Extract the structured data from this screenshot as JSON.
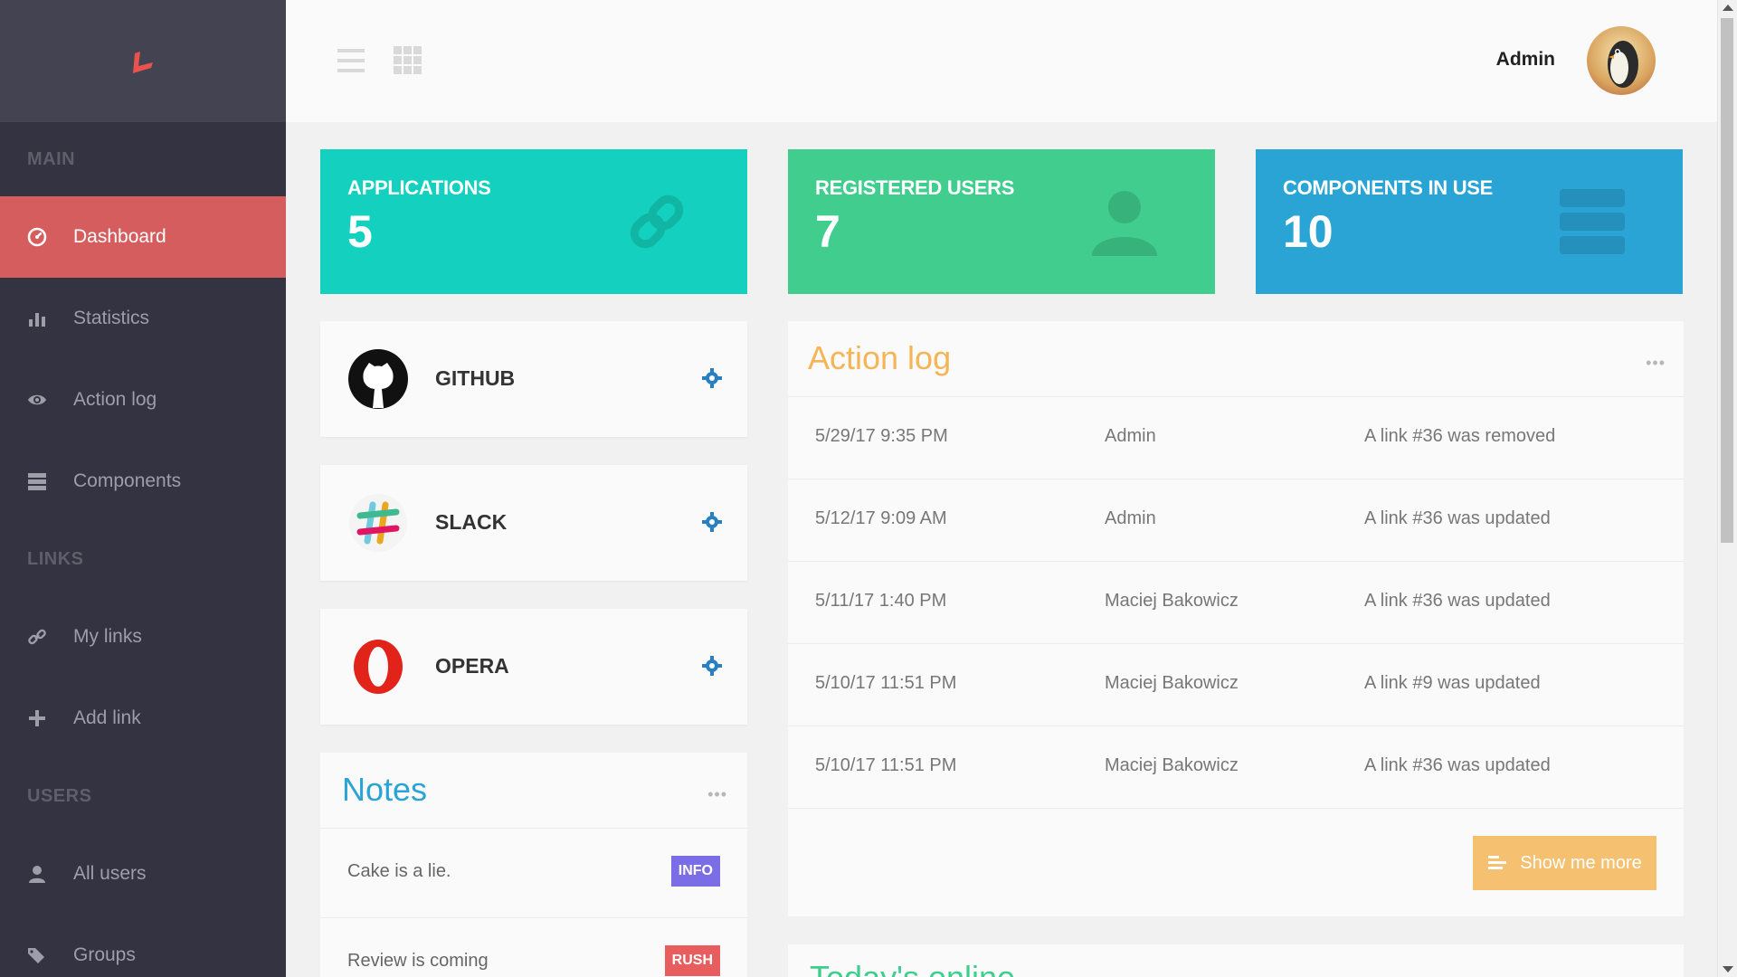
{
  "sidebar": {
    "sections": [
      {
        "title": "MAIN"
      },
      {
        "title": "LINKS"
      },
      {
        "title": "USERS"
      }
    ],
    "items": [
      {
        "label": "Dashboard",
        "icon": "dashboard-icon",
        "active": true
      },
      {
        "label": "Statistics",
        "icon": "bar-chart-icon"
      },
      {
        "label": "Action log",
        "icon": "eye-icon"
      },
      {
        "label": "Components",
        "icon": "server-icon"
      },
      {
        "label": "My links",
        "icon": "link-icon"
      },
      {
        "label": "Add link",
        "icon": "plus-icon"
      },
      {
        "label": "All users",
        "icon": "user-icon"
      },
      {
        "label": "Groups",
        "icon": "tags-icon"
      }
    ]
  },
  "header": {
    "user_name": "Admin"
  },
  "stats": [
    {
      "label": "APPLICATIONS",
      "value": "5",
      "color": "#13d1be"
    },
    {
      "label": "REGISTERED USERS",
      "value": "7",
      "color": "#40cd8e"
    },
    {
      "label": "COMPONENTS IN USE",
      "value": "10",
      "color": "#2aa4d5"
    }
  ],
  "apps": [
    {
      "name": "GITHUB"
    },
    {
      "name": "SLACK"
    },
    {
      "name": "OPERA"
    }
  ],
  "notes": {
    "title": "Notes",
    "more": "•••",
    "items": [
      {
        "text": "Cake is a lie.",
        "badge": "INFO",
        "badge_color": "#7b6de6"
      },
      {
        "text": "Review is coming",
        "badge": "RUSH",
        "badge_color": "#e85d5d"
      }
    ]
  },
  "action_log": {
    "title": "Action log",
    "more": "•••",
    "rows": [
      {
        "date": "5/29/17 9:35 PM",
        "user": "Admin",
        "message": "A link #36 was removed"
      },
      {
        "date": "5/12/17 9:09 AM",
        "user": "Admin",
        "message": "A link #36 was updated"
      },
      {
        "date": "5/11/17 1:40 PM",
        "user": "Maciej Bakowicz",
        "message": "A link #36 was updated"
      },
      {
        "date": "5/10/17 11:51 PM",
        "user": "Maciej Bakowicz",
        "message": "A link #9 was updated"
      },
      {
        "date": "5/10/17 11:51 PM",
        "user": "Maciej Bakowicz",
        "message": "A link #36 was updated"
      }
    ],
    "button_label": "Show me more"
  },
  "todays_online": {
    "title": "Today's online"
  },
  "colors": {
    "sidebar_bg": "#343341",
    "active_item": "#d65d5d",
    "notes_title": "#2aa4d5",
    "action_log_title": "#f5b455",
    "show_more": "#f5c170"
  }
}
